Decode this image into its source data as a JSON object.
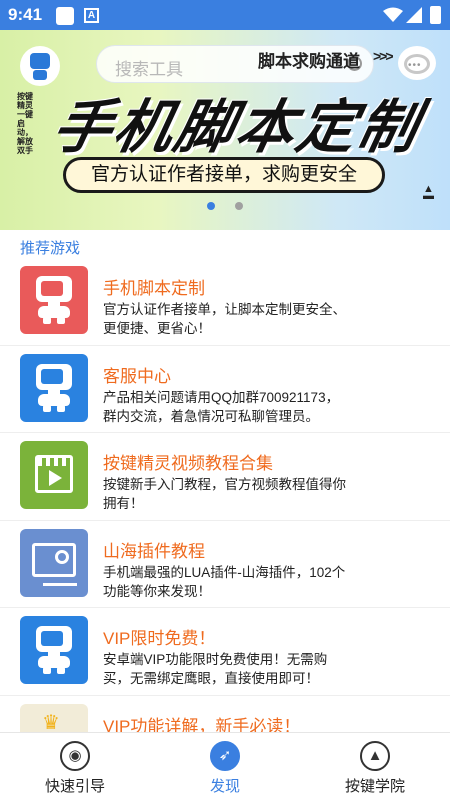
{
  "status_bar": {
    "time": "9:41",
    "notification_icon": "A"
  },
  "banner": {
    "search_placeholder": "搜索工具",
    "promo_text": "脚本求购通道",
    "headline": "手机脚本定制",
    "subline": "官方认证作者接单，求购更安全",
    "vertical_text": "按键精灵 一键启动，解放双手",
    "carousel": {
      "pages": 2,
      "active_index": 0
    }
  },
  "section": {
    "title": "推荐游戏"
  },
  "items": [
    {
      "title": "手机脚本定制",
      "desc": "官方认证作者接单，让脚本定制更安全、更便捷、更省心！",
      "thumb_color": "#e95a5a",
      "icon": "robot-icon"
    },
    {
      "title": "客服中心",
      "desc": "产品相关问题请用QQ加群700921173，群内交流，着急情况可私聊管理员。",
      "thumb_color": "#2a82e0",
      "icon": "robot-icon"
    },
    {
      "title": "按键精灵视频教程合集",
      "desc": "按键新手入门教程，官方视频教程值得你拥有！",
      "thumb_color": "#7bb33a",
      "icon": "video-icon"
    },
    {
      "title": "山海插件教程",
      "desc": "手机端最强的LUA插件-山海插件，102个功能等你来发现！",
      "thumb_color": "#6a8fd0",
      "icon": "plugin-icon"
    },
    {
      "title": "VIP限时免费！",
      "desc": "安卓端VIP功能限时免费使用！无需购买，无需绑定鹰眼，直接使用即可！",
      "thumb_color": "#2a82e0",
      "icon": "robot-icon"
    },
    {
      "title": "VIP功能详解，新手必读！",
      "desc": "",
      "thumb_color": "#f2ecd8",
      "icon": "crown-icon"
    }
  ],
  "bottom_nav": [
    {
      "label": "快速引导",
      "icon": "lightbulb-icon",
      "active": false
    },
    {
      "label": "发现",
      "icon": "compass-icon",
      "active": true
    },
    {
      "label": "按键学院",
      "icon": "graduation-cap-icon",
      "active": false
    }
  ],
  "colors": {
    "accent": "#3a7fe0",
    "title_orange": "#ef6b1f"
  }
}
